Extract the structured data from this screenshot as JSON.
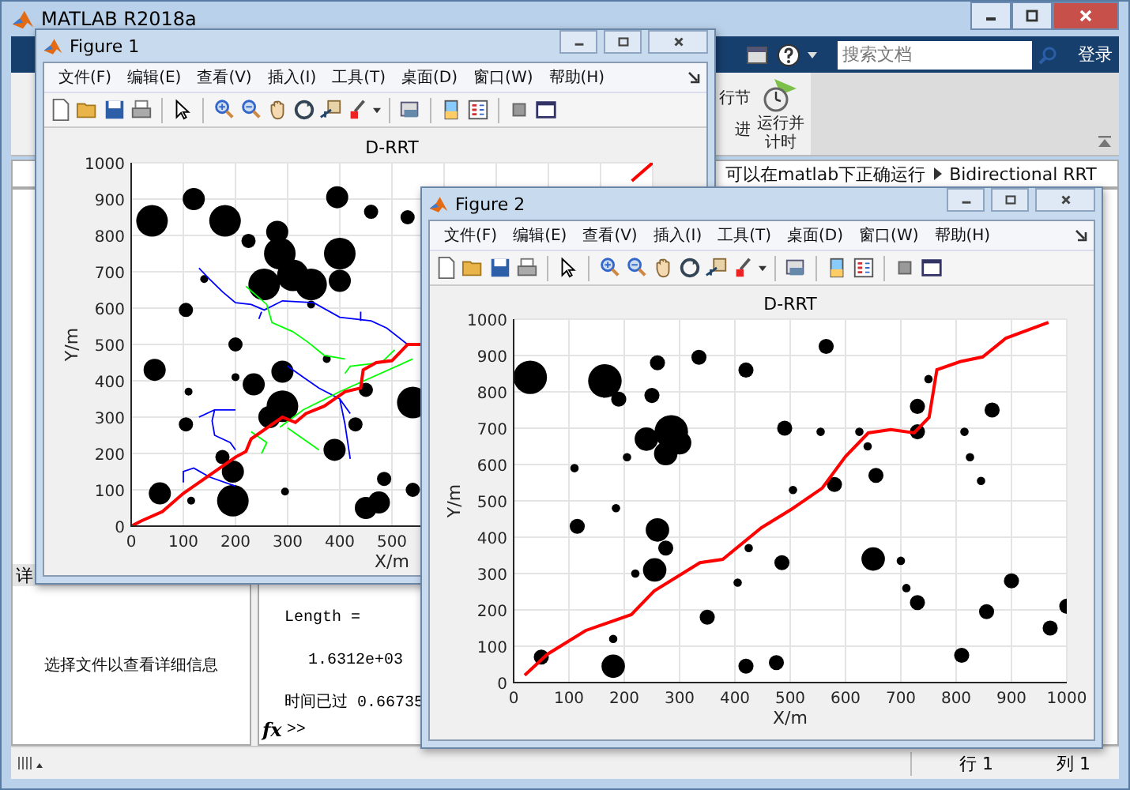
{
  "main_window": {
    "title": "MATLAB R2018a"
  },
  "toolstrip": {
    "search": {
      "placeholder": "搜索文档"
    },
    "login": "登录",
    "section_labels": [
      "行节",
      "进"
    ],
    "run_time_button": [
      "运行并",
      "计时"
    ]
  },
  "address_bar": {
    "path": [
      "可以在matlab下正确运行",
      "Bidirectional RRT"
    ]
  },
  "details_panel": {
    "tab": "详",
    "message": "选择文件以查看详细信息"
  },
  "command_window": {
    "lines": [
      "Length =",
      "1.6312e+03",
      "时间已过 0.66735"
    ],
    "function_button": "fx",
    "prompt": ">>"
  },
  "status_bar": {
    "row": "行 1",
    "col": "列 1"
  },
  "figures": [
    {
      "title": "Figure 1",
      "menu": [
        "文件(F)",
        "编辑(E)",
        "查看(V)",
        "插入(I)",
        "工具(T)",
        "桌面(D)",
        "窗口(W)",
        "帮助(H)"
      ],
      "chart_data": {
        "type": "scatter",
        "title": "D-RRT",
        "xlabel": "X/m",
        "ylabel": "Y/m",
        "xlim": [
          0,
          1000
        ],
        "ylim": [
          0,
          1000
        ],
        "xticks": [
          0,
          100,
          200,
          300,
          400,
          500
        ],
        "yticks": [
          0,
          100,
          200,
          300,
          400,
          500,
          600,
          700,
          800,
          900,
          1000
        ],
        "grid": true,
        "series": [
          {
            "color": "#000000",
            "x": [
              40,
              180,
              285,
              255,
              310,
              345,
              400,
              290,
              195,
              540
            ],
            "values": [
              840,
              840,
              750,
              665,
              690,
              665,
              750,
              330,
              70,
              340
            ]
          },
          {
            "color": "#000000",
            "x": [
              120,
              280,
              400,
              395,
              45,
              235,
              290,
              265,
              195,
              55,
              390,
              450,
              475
            ],
            "values": [
              900,
              810,
              675,
              905,
              430,
              390,
              425,
              300,
              150,
              90,
              210,
              50,
              65
            ]
          },
          {
            "color": "#000000",
            "x": [
              225,
              460,
              530,
              105,
              200,
              105,
              175,
              430,
              450,
              485,
              540
            ],
            "values": [
              785,
              865,
              850,
              595,
              500,
              280,
              190,
              280,
              375,
              130,
              100
            ]
          },
          {
            "color": "#000000",
            "x": [
              200,
              110,
              295,
              115,
              375,
              345,
              140
            ],
            "values": [
              410,
              370,
              95,
              70,
              460,
              610,
              680
            ]
          },
          {
            "type": "line",
            "color": "#0000ff",
            "x": [
              130,
              150,
              175,
              200,
              230,
              255,
              290,
              350,
              400,
              460,
              490,
              530,
              null,
              250,
              245,
              null,
              440,
              440,
              null,
              300,
              330,
              360,
              400,
              420,
              null,
              400,
              410,
              420,
              null,
              200,
              160,
              155,
              160,
              190,
              200,
              null,
              160,
              130,
              null,
              100,
              100,
              120,
              150,
              200
            ],
            "values": [
              710,
              680,
              645,
              615,
              610,
              595,
              620,
              615,
              575,
              565,
              545,
              500,
              null,
              590,
              570,
              null,
              590,
              565,
              null,
              440,
              410,
              380,
              350,
              310,
              null,
              350,
              280,
              185,
              null,
              320,
              320,
              290,
              250,
              230,
              210,
              null,
              320,
              300,
              null,
              120,
              150,
              160,
              135,
              110
            ]
          },
          {
            "type": "line",
            "color": "#00ff00",
            "x": [
              220,
              260,
              270,
              310,
              340,
              370,
              410,
              null,
              410,
              420,
              480,
              505,
              null,
              285,
              330,
              400,
              540,
              null,
              300,
              340,
              360,
              null,
              230,
              260,
              250
            ],
            "values": [
              660,
              610,
              560,
              535,
              505,
              470,
              460,
              null,
              420,
              440,
              450,
              485,
              null,
              272,
              320,
              370,
              460,
              null,
              270,
              230,
              210,
              null,
              260,
              230,
              200
            ]
          },
          {
            "type": "line",
            "color": "#ff0000",
            "x": [
              0,
              20,
              60,
              100,
              150,
              200,
              220,
              230,
              290,
              315,
              335,
              370,
              410,
              440,
              445,
              470,
              500,
              530,
              560,
              null,
              960,
              1000
            ],
            "values": [
              0,
              15,
              40,
              90,
              140,
              190,
              205,
              240,
              300,
              285,
              310,
              330,
              370,
              380,
              430,
              450,
              455,
              500,
              500,
              null,
              950,
              1000
            ]
          }
        ]
      }
    },
    {
      "title": "Figure 2",
      "menu": [
        "文件(F)",
        "编辑(E)",
        "查看(V)",
        "插入(I)",
        "工具(T)",
        "桌面(D)",
        "窗口(W)",
        "帮助(H)"
      ],
      "chart_data": {
        "type": "scatter",
        "title": "D-RRT",
        "xlabel": "X/m",
        "ylabel": "Y/m",
        "xlim": [
          0,
          1000
        ],
        "ylim": [
          0,
          1000
        ],
        "xticks": [
          0,
          100,
          200,
          300,
          400,
          500,
          600,
          700,
          800,
          900,
          1000
        ],
        "yticks": [
          0,
          100,
          200,
          300,
          400,
          500,
          600,
          700,
          800,
          900,
          1000
        ],
        "grid": true,
        "series": [
          {
            "color": "#000000",
            "x": [
              30,
              165,
              285
            ],
            "values": [
              840,
              830,
              690
            ]
          },
          {
            "color": "#000000",
            "x": [
              240,
              300,
              275,
              260,
              255,
              180,
              650
            ],
            "values": [
              670,
              660,
              630,
              420,
              310,
              45,
              340
            ]
          },
          {
            "color": "#000000",
            "x": [
              260,
              335,
              420,
              565,
              190,
              250,
              115,
              275,
              50,
              350,
              420,
              475,
              490,
              655,
              580,
              730,
              730,
              865,
              730,
              485,
              810,
              855,
              900,
              970,
              1000
            ],
            "values": [
              880,
              895,
              860,
              925,
              780,
              790,
              430,
              370,
              70,
              180,
              45,
              55,
              700,
              570,
              545,
              760,
              690,
              750,
              220,
              330,
              75,
              195,
              280,
              150,
              210
            ]
          },
          {
            "color": "#000000",
            "x": [
              110,
              205,
              185,
              220,
              180,
              505,
              555,
              625,
              640,
              750,
              815,
              825,
              845,
              700,
              710,
              425,
              405
            ],
            "values": [
              590,
              620,
              480,
              300,
              120,
              530,
              690,
              690,
              650,
              835,
              690,
              620,
              555,
              335,
              260,
              370,
              275
            ]
          },
          {
            "type": "line",
            "color": "#ff0000",
            "x": [
              20,
              61,
              130,
              213,
              254,
              337,
              378,
              448,
              503,
              558,
              600,
              641,
              682,
              724,
              751,
              765,
              807,
              848,
              890,
              967
            ],
            "values": [
              20,
              78,
              143,
              187,
              252,
              330,
              339,
              426,
              478,
              535,
              622,
              687,
              696,
              687,
              730,
              861,
              883,
              896,
              948,
              991
            ]
          }
        ]
      }
    }
  ]
}
